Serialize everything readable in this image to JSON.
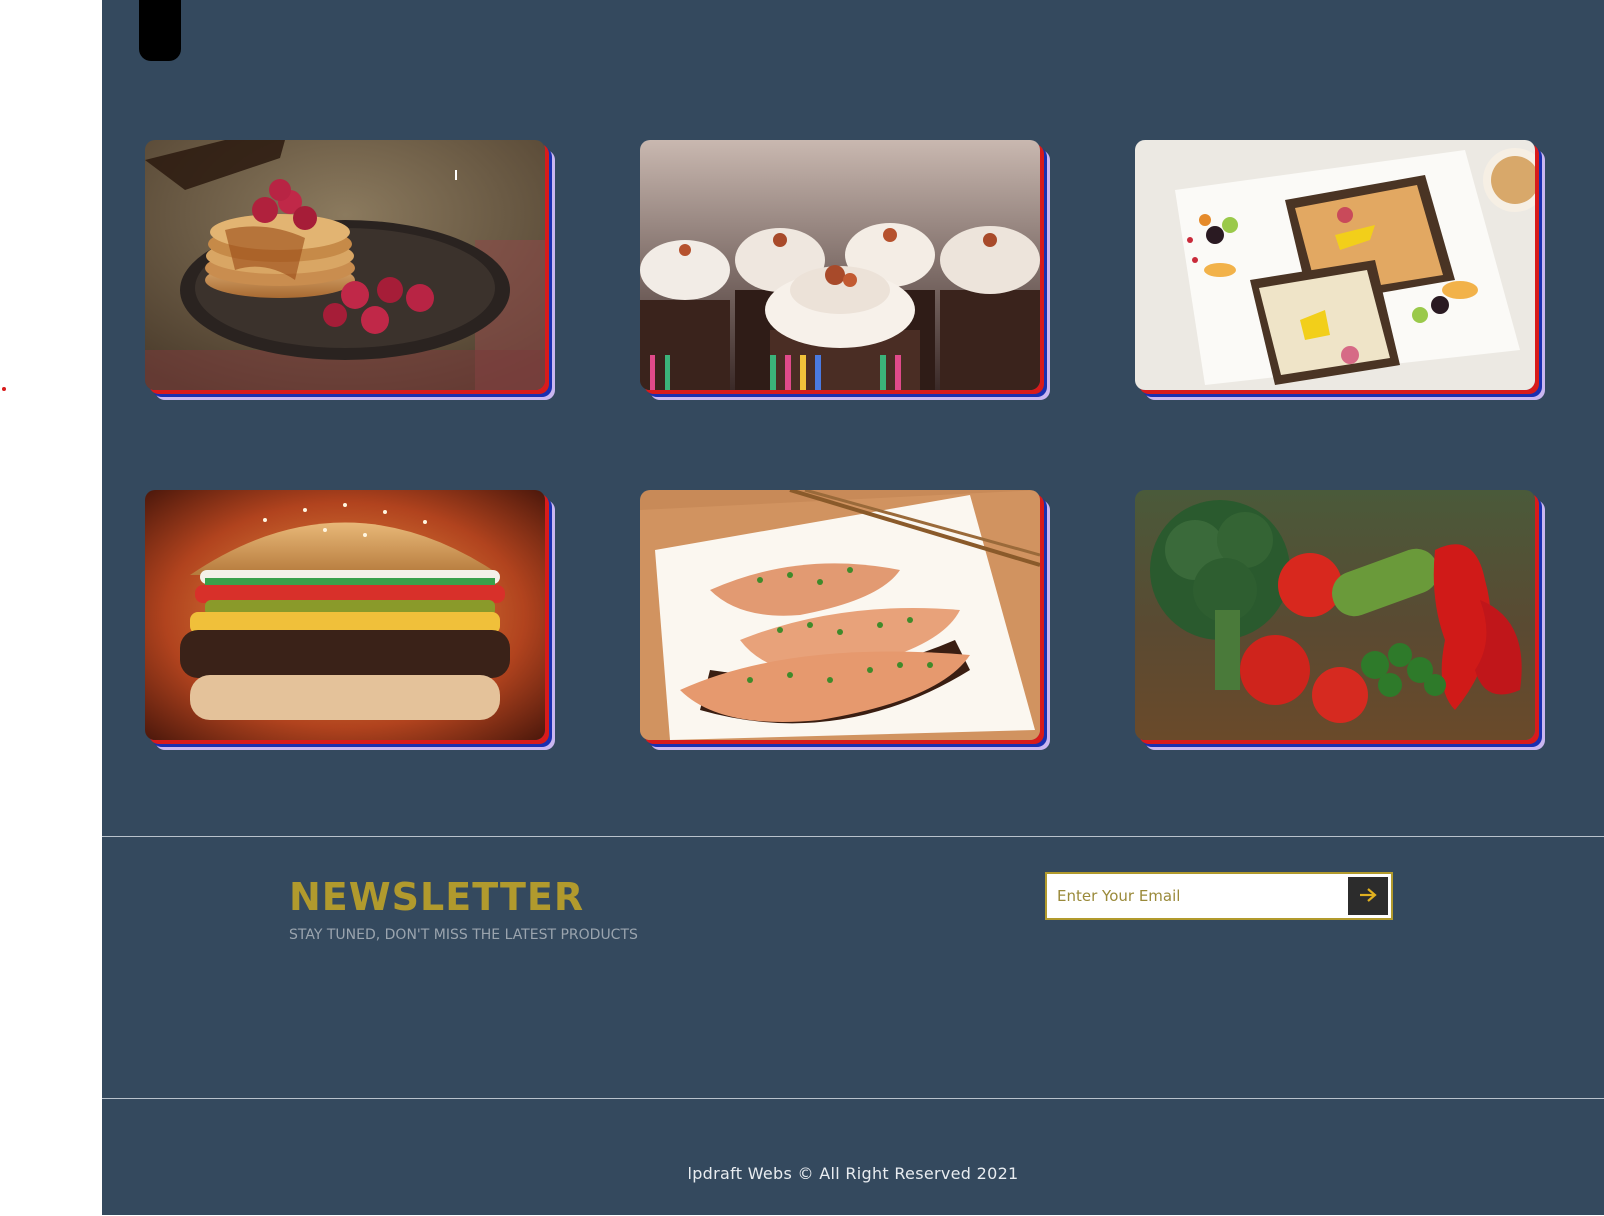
{
  "gallery": {
    "items": [
      {
        "name": "pancakes-image"
      },
      {
        "name": "cupcakes-image"
      },
      {
        "name": "toast-breakfast-image"
      },
      {
        "name": "burger-image"
      },
      {
        "name": "salmon-image"
      },
      {
        "name": "vegetables-image"
      }
    ]
  },
  "newsletter": {
    "title": "NEWSLETTER",
    "subtitle": "STAY TUNED, DON'T MISS THE LATEST PRODUCTS",
    "email_placeholder": "Enter Your Email",
    "submit_icon": "arrow-right-icon"
  },
  "footer": {
    "copyright": "lpdraft Webs © All Right Reserved 2021"
  },
  "colors": {
    "background": "#34495e",
    "accent": "#b19a2d",
    "card_shadow_red": "#d81b1b",
    "card_shadow_blue": "#1a2fb0"
  }
}
